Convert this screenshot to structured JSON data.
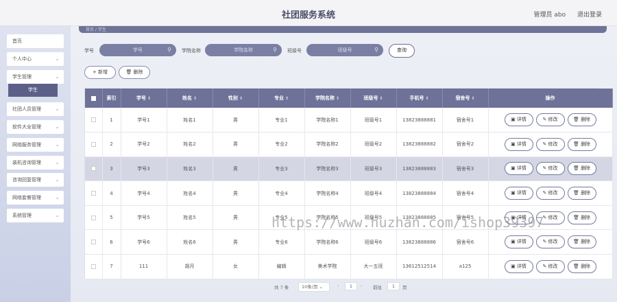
{
  "app": {
    "title": "社团服务系统",
    "user": "管理员 abo",
    "logout": "退出登录"
  },
  "sidebar": {
    "items": [
      {
        "label": "首页",
        "chevron": false
      },
      {
        "label": "个人中心",
        "chevron": true
      },
      {
        "label": "学生管理",
        "chevron": true
      },
      {
        "label": "社团人员管理",
        "chevron": true
      },
      {
        "label": "软件大全管理",
        "chevron": true
      },
      {
        "label": "网络服务管理",
        "chevron": true
      },
      {
        "label": "装机咨询管理",
        "chevron": true
      },
      {
        "label": "咨询回复管理",
        "chevron": true
      },
      {
        "label": "网络套餐管理",
        "chevron": true
      },
      {
        "label": "系统管理",
        "chevron": true
      }
    ],
    "active_sub": "学生"
  },
  "breadcrumb": "首页 / 学生",
  "search": {
    "fields": [
      {
        "label": "学号",
        "placeholder": "学号"
      },
      {
        "label": "学院名称",
        "placeholder": "学院名称"
      },
      {
        "label": "班级号",
        "placeholder": "班级号"
      }
    ],
    "query_button": "查询"
  },
  "actions": {
    "add": "+ 新增",
    "delete": "删除"
  },
  "table": {
    "columns": [
      "索引",
      "学号",
      "姓名",
      "性别",
      "专业",
      "学院名称",
      "班级号",
      "手机号",
      "宿舍号",
      "操作"
    ],
    "ops": {
      "detail": "详情",
      "edit": "修改",
      "delete": "删除"
    },
    "rows": [
      [
        "1",
        "学号1",
        "姓名1",
        "男",
        "专业1",
        "学院名称1",
        "班级号1",
        "13823888881",
        "宿舍号1"
      ],
      [
        "2",
        "学号2",
        "姓名2",
        "男",
        "专业2",
        "学院名称2",
        "班级号2",
        "13823888882",
        "宿舍号2"
      ],
      [
        "3",
        "学号3",
        "姓名3",
        "男",
        "专业3",
        "学院名称3",
        "班级号3",
        "13823888883",
        "宿舍号3"
      ],
      [
        "4",
        "学号4",
        "姓名4",
        "男",
        "专业4",
        "学院名称4",
        "班级号4",
        "13823888884",
        "宿舍号4"
      ],
      [
        "5",
        "学号5",
        "姓名5",
        "男",
        "专业5",
        "学院名称5",
        "班级号5",
        "13823888885",
        "宿舍号5"
      ],
      [
        "6",
        "学号6",
        "姓名6",
        "男",
        "专业6",
        "学院名称6",
        "班级号6",
        "13823888886",
        "宿舍号6"
      ],
      [
        "7",
        "111",
        "胡月",
        "女",
        "编辑",
        "美术学院",
        "大一五班",
        "13612512514",
        "a125"
      ]
    ],
    "highlight_row": 2
  },
  "pagination": {
    "total": "共 7 条",
    "page_size": "10条/页",
    "current": "1",
    "goto_label": "前往",
    "goto_value": "1",
    "page_suffix": "页"
  },
  "watermark": "https://www.huzhan.com/ishop39397"
}
